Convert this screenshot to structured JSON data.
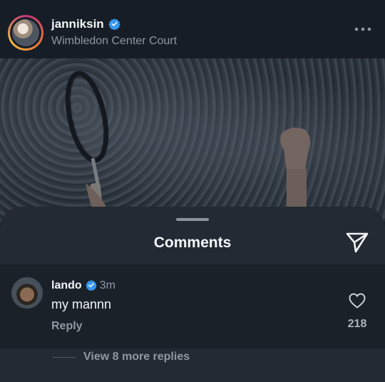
{
  "post": {
    "username": "janniksin",
    "location": "Wimbledon Center Court",
    "verified": true
  },
  "comments_sheet": {
    "title": "Comments",
    "comments": [
      {
        "username": "lando",
        "verified": true,
        "time": "3m",
        "text": "my mannn",
        "reply_label": "Reply",
        "likes": "218"
      }
    ],
    "more_replies": "View 8 more replies"
  },
  "colors": {
    "verified_badge": "#3797f0",
    "sheet_bg": "#232a33",
    "comment_bg": "#1b2129",
    "secondary_text": "#8f98a3"
  },
  "icons": [
    "more-horizontal-icon",
    "verified-icon",
    "send-icon",
    "heart-icon"
  ]
}
